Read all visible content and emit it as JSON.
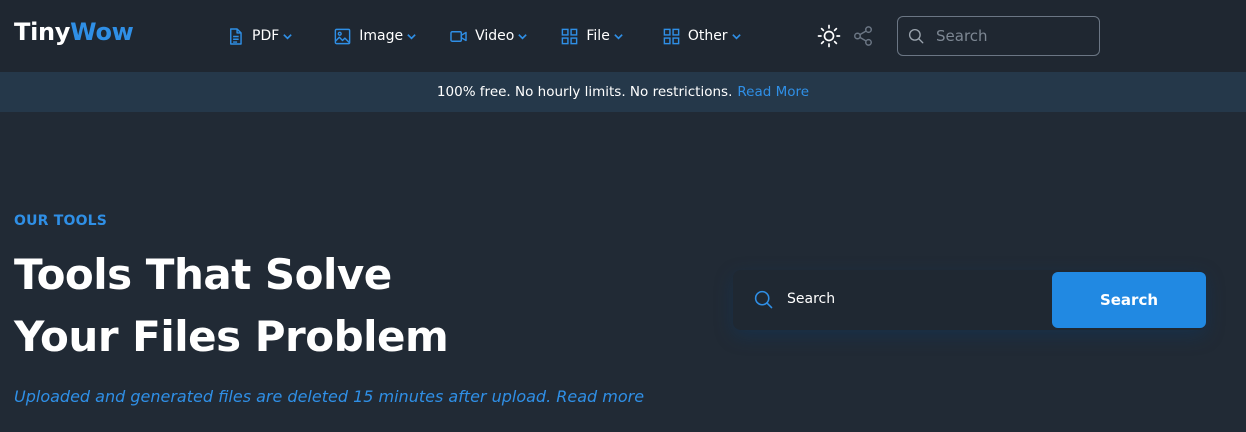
{
  "brand": {
    "name_part1": "Tiny",
    "name_part2": "Wow",
    "accent": "#2f8fe6"
  },
  "nav": {
    "items": [
      {
        "label": "PDF",
        "icon": "file-icon"
      },
      {
        "label": "Image",
        "icon": "image-icon"
      },
      {
        "label": "Video",
        "icon": "video-camera-icon"
      },
      {
        "label": "File",
        "icon": "grid-icon"
      },
      {
        "label": "Other",
        "icon": "grid-icon"
      }
    ],
    "theme_icon": "sun-icon",
    "share_icon": "share-icon",
    "search_placeholder": "Search"
  },
  "banner": {
    "text": "100% free. No hourly limits. No restrictions.",
    "link": "Read More"
  },
  "hero": {
    "eyebrow": "OUR TOOLS",
    "title_line1": "Tools That Solve",
    "title_line2": "Your Files Problem",
    "subtext": "Uploaded and generated files are deleted 15 minutes after upload.",
    "subtext_link": "Read more",
    "search_placeholder": "Search",
    "search_button": "Search"
  },
  "colors": {
    "background": "#212a35",
    "nav_background": "#1f2731",
    "banner_background": "#25384a",
    "button": "#2189e2"
  }
}
